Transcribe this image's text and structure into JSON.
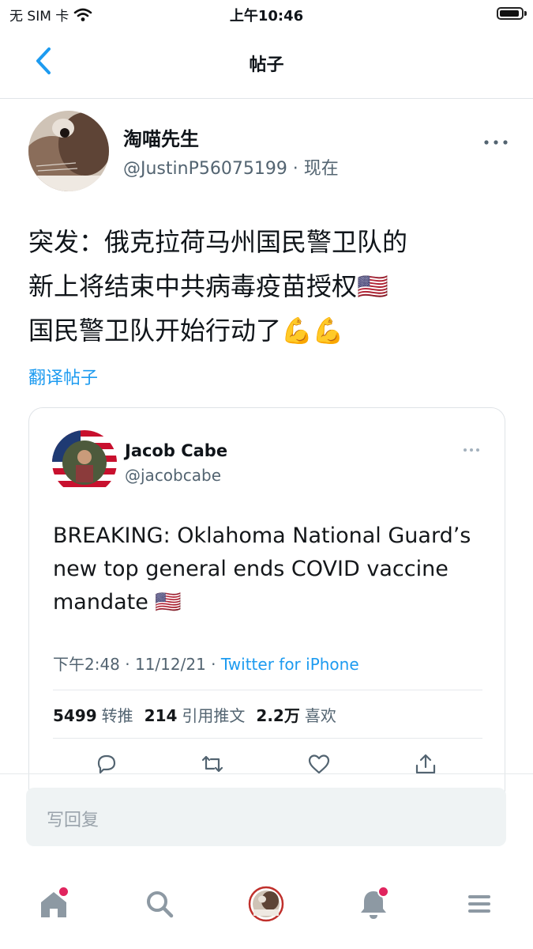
{
  "status_bar": {
    "carrier": "无 SIM 卡",
    "time": "上午10:46",
    "icons": [
      "wifi-icon",
      "battery-icon"
    ]
  },
  "nav": {
    "title": "帖子",
    "back_icon": "chevron-left-icon",
    "accent_color": "#1d9bf0"
  },
  "post": {
    "author_name": "淘喵先生",
    "author_handle": "@JustinP56075199 · 现在",
    "text_lines": [
      "突发：俄克拉荷马州国民警卫队的",
      "新上将结束中共病毒疫苗授权🇺🇸",
      "国民警卫队开始行动了💪💪"
    ],
    "translate_label": "翻译帖子"
  },
  "quoted": {
    "name": "Jacob Cabe",
    "handle": "@jacobcabe",
    "text": "BREAKING: Oklahoma National Guard’s new top general ends COVID vaccine mandate 🇺🇸",
    "time": "下午2:48 · 11/12/21 · ",
    "via": "Twitter for iPhone",
    "retweets": "5499",
    "retweets_label": "转推",
    "quotes": "214",
    "quotes_label": "引用推文",
    "likes": "2.2万",
    "likes_label": "喜欢",
    "actions": [
      "reply-icon",
      "retweet-icon",
      "like-icon",
      "share-icon"
    ]
  },
  "reply": {
    "placeholder": "写回复"
  },
  "tabbar": {
    "items": [
      "home-icon",
      "search-icon",
      "profile-avatar",
      "notifications-icon",
      "menu-icon"
    ],
    "badge_color": "#e0245e"
  }
}
